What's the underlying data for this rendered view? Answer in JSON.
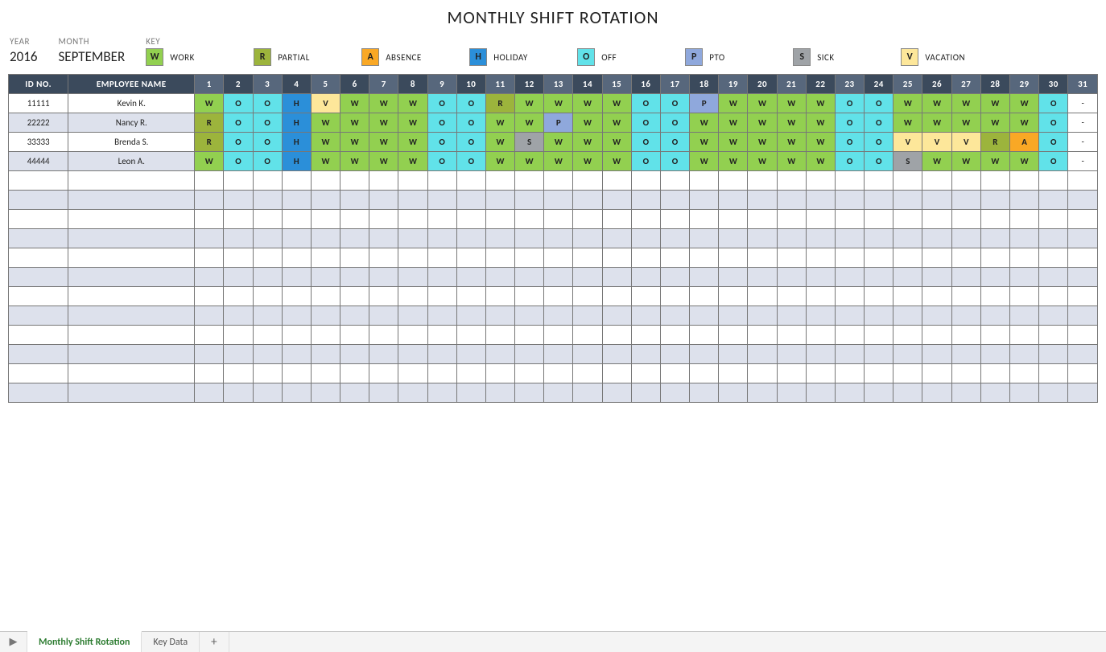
{
  "title": "MONTHLY SHIFT ROTATION",
  "labels": {
    "year": "YEAR",
    "month": "MONTH",
    "key": "KEY",
    "id": "ID NO.",
    "name": "EMPLOYEE NAME"
  },
  "year": "2016",
  "month": "SEPTEMBER",
  "legend": [
    {
      "code": "W",
      "label": "WORK"
    },
    {
      "code": "R",
      "label": "PARTIAL"
    },
    {
      "code": "A",
      "label": "ABSENCE"
    },
    {
      "code": "H",
      "label": "HOLIDAY"
    },
    {
      "code": "O",
      "label": "OFF"
    },
    {
      "code": "P",
      "label": "PTO"
    },
    {
      "code": "S",
      "label": "SICK"
    },
    {
      "code": "V",
      "label": "VACATION"
    }
  ],
  "days": [
    "1",
    "2",
    "3",
    "4",
    "5",
    "6",
    "7",
    "8",
    "9",
    "10",
    "11",
    "12",
    "13",
    "14",
    "15",
    "16",
    "17",
    "18",
    "19",
    "20",
    "21",
    "22",
    "23",
    "24",
    "25",
    "26",
    "27",
    "28",
    "29",
    "30",
    "31"
  ],
  "rows": [
    {
      "id": "11111",
      "name": "Kevin K.",
      "codes": [
        "W",
        "O",
        "O",
        "H",
        "V",
        "W",
        "W",
        "W",
        "O",
        "O",
        "R",
        "W",
        "W",
        "W",
        "W",
        "O",
        "O",
        "P",
        "W",
        "W",
        "W",
        "W",
        "O",
        "O",
        "W",
        "W",
        "W",
        "W",
        "W",
        "O",
        "-"
      ]
    },
    {
      "id": "22222",
      "name": "Nancy R.",
      "codes": [
        "R",
        "O",
        "O",
        "H",
        "W",
        "W",
        "W",
        "W",
        "O",
        "O",
        "W",
        "W",
        "P",
        "W",
        "W",
        "O",
        "O",
        "W",
        "W",
        "W",
        "W",
        "W",
        "O",
        "O",
        "W",
        "W",
        "W",
        "W",
        "W",
        "O",
        "-"
      ]
    },
    {
      "id": "33333",
      "name": "Brenda S.",
      "codes": [
        "R",
        "O",
        "O",
        "H",
        "W",
        "W",
        "W",
        "W",
        "O",
        "O",
        "W",
        "S",
        "W",
        "W",
        "W",
        "O",
        "O",
        "W",
        "W",
        "W",
        "W",
        "W",
        "O",
        "O",
        "V",
        "V",
        "V",
        "R",
        "A",
        "O",
        "-"
      ]
    },
    {
      "id": "44444",
      "name": "Leon A.",
      "codes": [
        "W",
        "O",
        "O",
        "H",
        "W",
        "W",
        "W",
        "W",
        "O",
        "O",
        "W",
        "W",
        "W",
        "W",
        "W",
        "O",
        "O",
        "W",
        "W",
        "W",
        "W",
        "W",
        "O",
        "O",
        "S",
        "W",
        "W",
        "W",
        "W",
        "O",
        "-"
      ]
    }
  ],
  "empty_rows": 12,
  "tabs": {
    "active": "Monthly Shift Rotation",
    "other": "Key Data"
  }
}
